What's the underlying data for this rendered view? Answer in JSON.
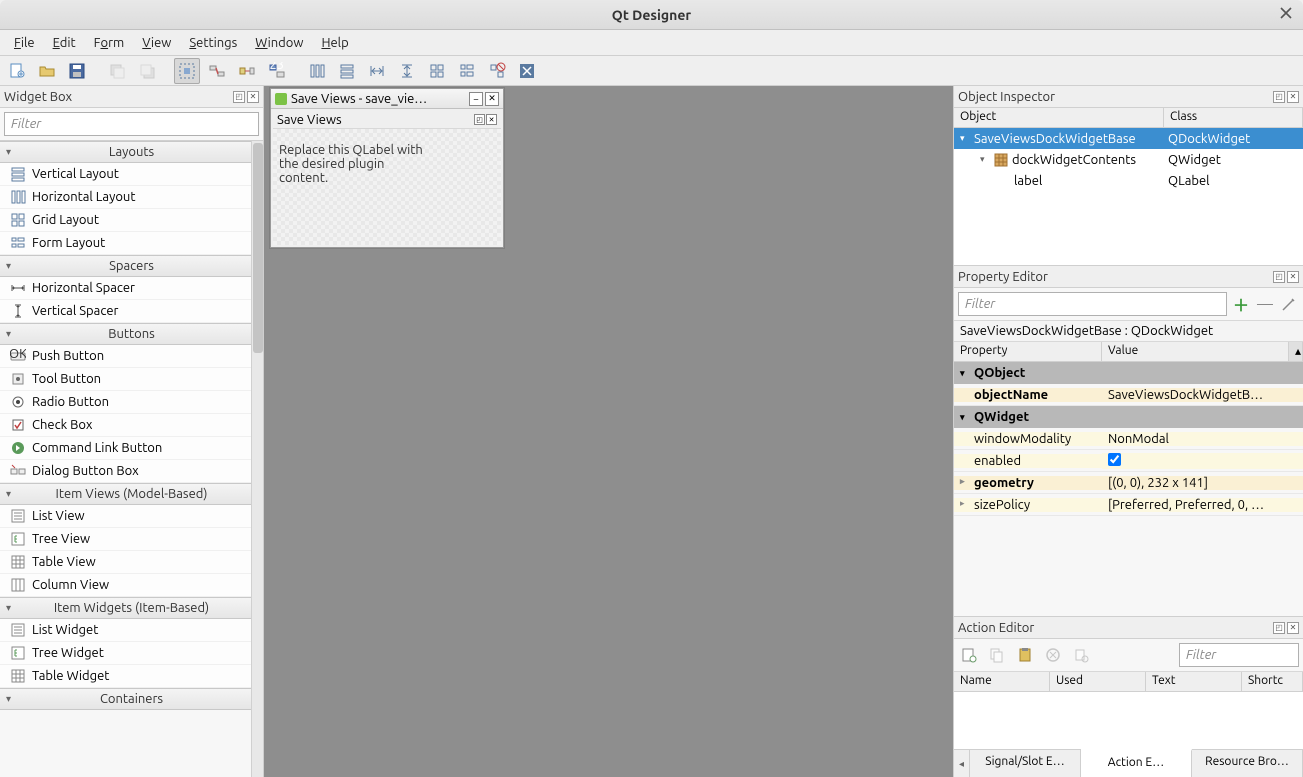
{
  "window": {
    "title": "Qt Designer"
  },
  "menu": {
    "file": "File",
    "edit": "Edit",
    "form": "Form",
    "view": "View",
    "settings": "Settings",
    "window": "Window",
    "help": "Help"
  },
  "widgetbox": {
    "title": "Widget Box",
    "filter_placeholder": "Filter",
    "categories": [
      {
        "name": "Layouts",
        "items": [
          "Vertical Layout",
          "Horizontal Layout",
          "Grid Layout",
          "Form Layout"
        ]
      },
      {
        "name": "Spacers",
        "items": [
          "Horizontal Spacer",
          "Vertical Spacer"
        ]
      },
      {
        "name": "Buttons",
        "items": [
          "Push Button",
          "Tool Button",
          "Radio Button",
          "Check Box",
          "Command Link Button",
          "Dialog Button Box"
        ]
      },
      {
        "name": "Item Views (Model-Based)",
        "items": [
          "List View",
          "Tree View",
          "Table View",
          "Column View"
        ]
      },
      {
        "name": "Item Widgets (Item-Based)",
        "items": [
          "List Widget",
          "Tree Widget",
          "Table Widget"
        ]
      },
      {
        "name": "Containers",
        "items": []
      }
    ]
  },
  "design": {
    "window_title": "Save Views - save_vie…",
    "sub_title": "Save Views",
    "label_text": "Replace this QLabel with the desired plugin content."
  },
  "object_inspector": {
    "title": "Object Inspector",
    "headers": [
      "Object",
      "Class"
    ],
    "rows": [
      {
        "object": "SaveViewsDockWidgetBase",
        "class": "QDockWidget",
        "indent": 0,
        "expanded": true,
        "selected": true
      },
      {
        "object": "dockWidgetContents",
        "class": "QWidget",
        "indent": 1,
        "expanded": true,
        "selected": false,
        "icon": "grid"
      },
      {
        "object": "label",
        "class": "QLabel",
        "indent": 2,
        "expanded": false,
        "selected": false
      }
    ]
  },
  "property_editor": {
    "title": "Property Editor",
    "filter_placeholder": "Filter",
    "object_title": "SaveViewsDockWidgetBase : QDockWidget",
    "headers": [
      "Property",
      "Value"
    ],
    "groups": [
      {
        "name": "QObject",
        "rows": [
          {
            "name": "objectName",
            "value": "SaveViewsDockWidgetB…",
            "bold": true
          }
        ]
      },
      {
        "name": "QWidget",
        "rows": [
          {
            "name": "windowModality",
            "value": "NonModal",
            "yel": true
          },
          {
            "name": "enabled",
            "value": "✓",
            "yel": true,
            "checkbox": true
          },
          {
            "name": "geometry",
            "value": "[(0, 0), 232 x 141]",
            "bold": true,
            "expand": true
          },
          {
            "name": "sizePolicy",
            "value": "[Preferred, Preferred, 0, …",
            "yel": true,
            "expand": true
          }
        ]
      }
    ]
  },
  "action_editor": {
    "title": "Action Editor",
    "filter_placeholder": "Filter",
    "headers": [
      "Name",
      "Used",
      "Text",
      "Shortc"
    ],
    "tabs": [
      "Signal/Slot E…",
      "Action E…",
      "Resource Bro…"
    ],
    "active_tab": 1
  }
}
